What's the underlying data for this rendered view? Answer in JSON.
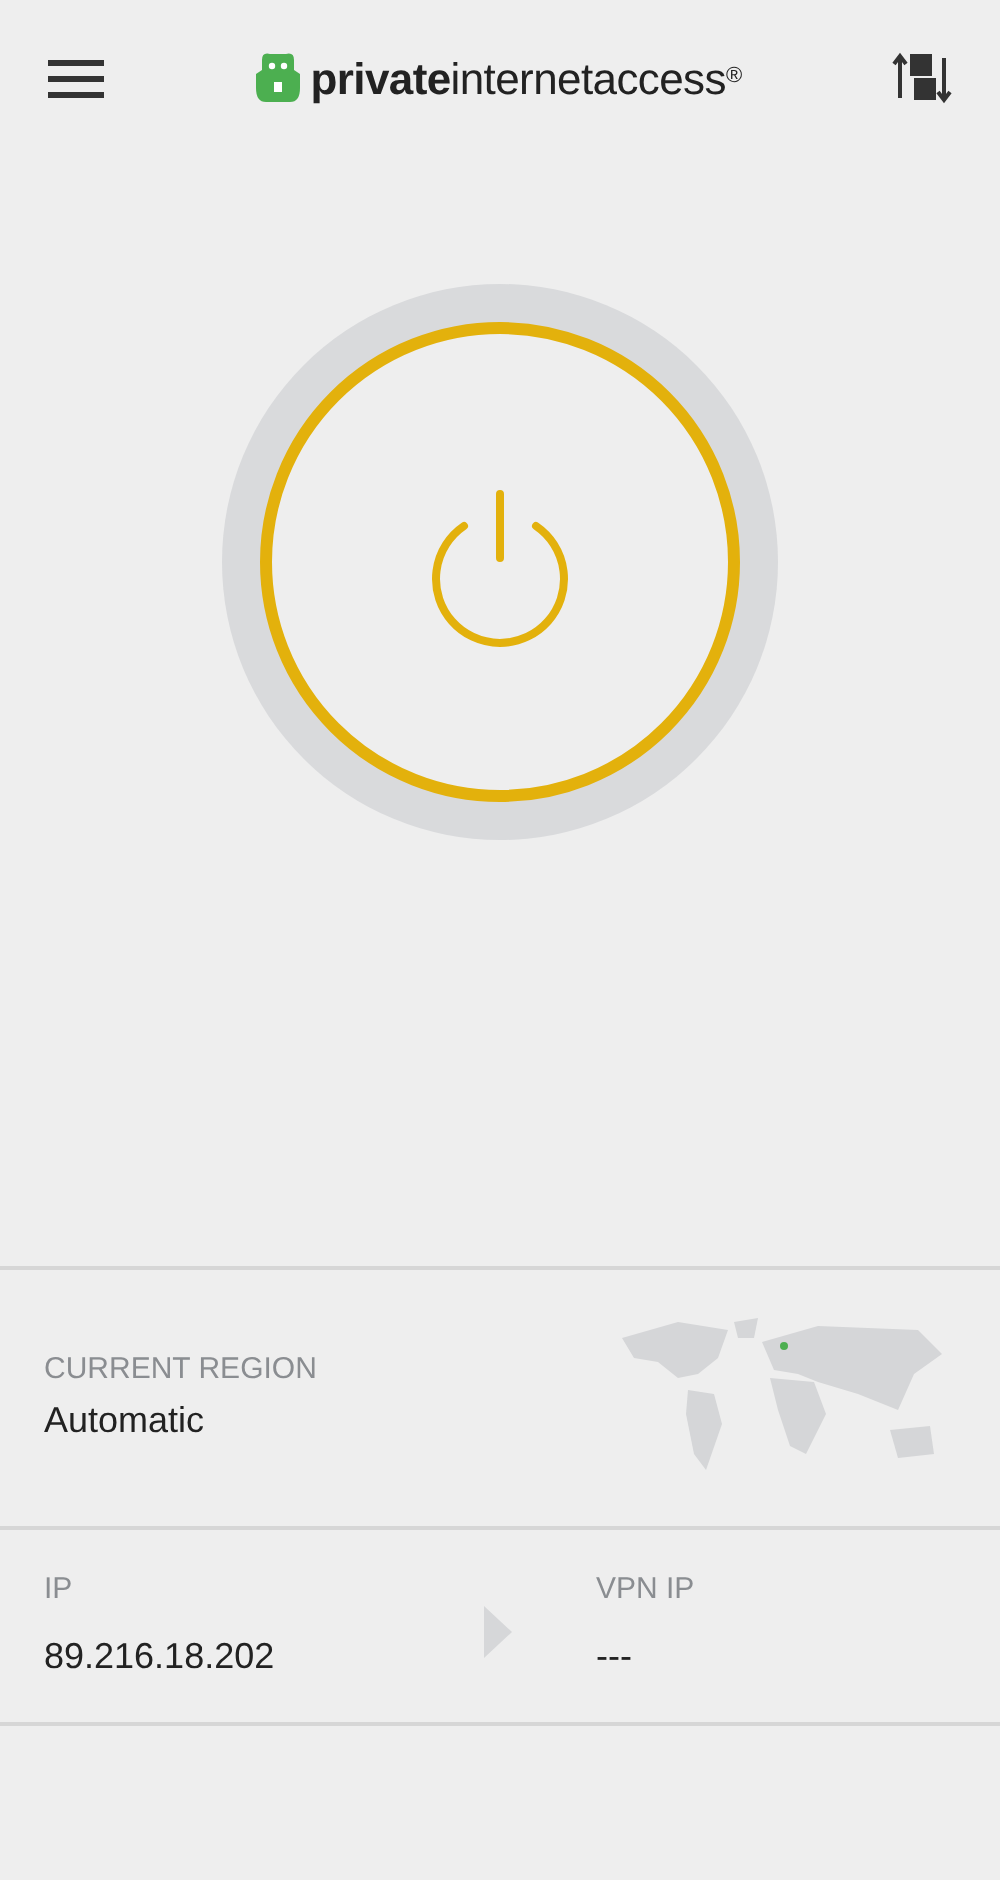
{
  "header": {
    "logo": "**private**internetaccess$^{®}$"
  },
  "power_button": {
    "on": false
  },
  "region": {
    "label": "CURRENT REGION",
    "value": "Automatic"
  },
  "ip": {
    "label": "IP",
    "value": "89.216.18.202"
  },
  "vpn_ip": {
    "label": "VPN IP",
    "value": "---"
  }
}
